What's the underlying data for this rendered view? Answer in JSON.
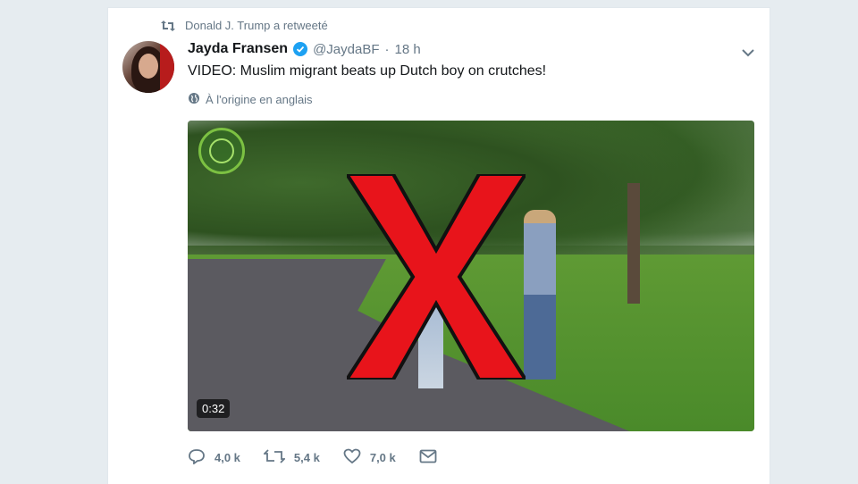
{
  "retweet_context": {
    "text": "Donald J. Trump a retweeté"
  },
  "author": {
    "name": "Jayda Fransen",
    "handle": "@JaydaBF",
    "separator": "·",
    "time": "18 h"
  },
  "tweet": {
    "text": "VIDEO: Muslim migrant beats up Dutch boy on crutches!",
    "translation_note": "À l'origine en anglais"
  },
  "media": {
    "duration": "0:32"
  },
  "actions": {
    "replies": "4,0 k",
    "retweets": "5,4 k",
    "likes": "7,0 k"
  },
  "colors": {
    "verified": "#1da1f2",
    "muted_text": "#657786",
    "overlay_x": "#e8141b"
  }
}
